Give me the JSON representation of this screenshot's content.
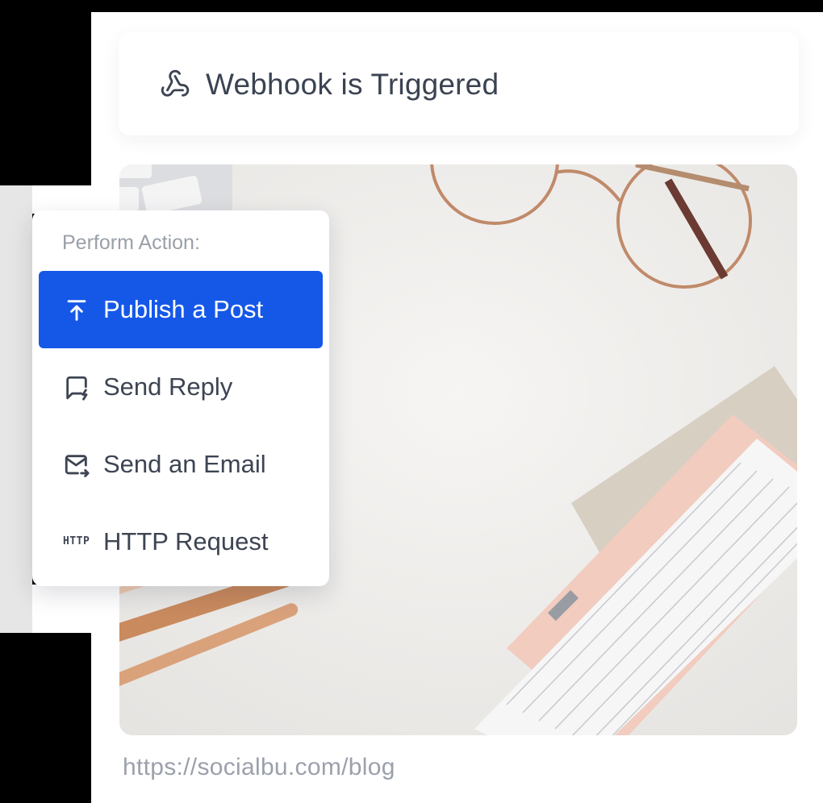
{
  "trigger": {
    "title": "Webhook is Triggered",
    "icon": "webhook-icon"
  },
  "menu": {
    "title": "Perform Action:",
    "items": [
      {
        "label": "Publish a Post",
        "icon": "upload-icon",
        "active": true
      },
      {
        "label": "Send Reply",
        "icon": "reply-icon",
        "active": false
      },
      {
        "label": "Send an Email",
        "icon": "email-send-icon",
        "active": false
      },
      {
        "label": "HTTP Request",
        "icon": "http-icon",
        "icon_text": "HTTP",
        "active": false
      }
    ]
  },
  "post": {
    "image": "desk-photo",
    "url": "https://socialbu.com/blog"
  },
  "colors": {
    "accent": "#1558e8",
    "text": "#3d4452",
    "muted": "#9aa0a8"
  }
}
